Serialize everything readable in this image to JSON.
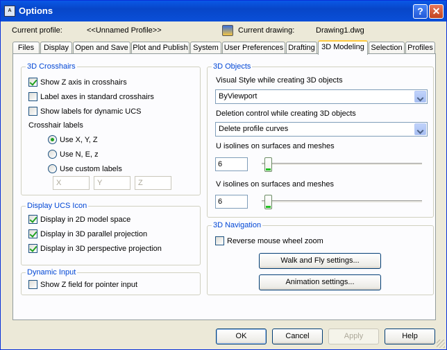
{
  "window": {
    "title": "Options",
    "icon": "autocad-icon",
    "help_glyph": "?",
    "close_glyph": "✕"
  },
  "profile": {
    "current_profile_label": "Current profile:",
    "current_profile_value": "<<Unnamed Profile>>",
    "current_drawing_label": "Current drawing:",
    "current_drawing_value": "Drawing1.dwg"
  },
  "tabs": [
    "Files",
    "Display",
    "Open and Save",
    "Plot and Publish",
    "System",
    "User Preferences",
    "Drafting",
    "3D Modeling",
    "Selection",
    "Profiles"
  ],
  "active_tab": "3D Modeling",
  "crosshairs": {
    "title": "3D Crosshairs",
    "show_z": {
      "label": "Show Z axis in crosshairs",
      "checked": true
    },
    "label_axes": {
      "label": "Label axes in standard crosshairs",
      "checked": false
    },
    "show_labels_ucs": {
      "label": "Show labels for dynamic UCS",
      "checked": false
    },
    "crosshair_labels_title": "Crosshair labels",
    "radios": [
      {
        "label": "Use X, Y, Z",
        "checked": true
      },
      {
        "label": "Use N, E, z",
        "checked": false
      },
      {
        "label": "Use custom labels",
        "checked": false
      }
    ],
    "custom": [
      "X",
      "Y",
      "Z"
    ]
  },
  "ucs_icon": {
    "title": "Display UCS Icon",
    "items": [
      {
        "label": "Display in 2D model space",
        "checked": true
      },
      {
        "label": "Display in 3D parallel projection",
        "checked": true
      },
      {
        "label": "Display in 3D perspective projection",
        "checked": true
      }
    ]
  },
  "dynamic_input": {
    "title": "Dynamic Input",
    "show_z_field": {
      "label": "Show Z field for pointer input",
      "checked": false
    }
  },
  "objects": {
    "title": "3D Objects",
    "visual_style_label": "Visual Style while creating 3D objects",
    "visual_style_value": "ByViewport",
    "deletion_label": "Deletion control while creating 3D objects",
    "deletion_value": "Delete profile curves",
    "u_isolines_label": "U isolines on surfaces and meshes",
    "u_isolines_value": "6",
    "v_isolines_label": "V isolines on surfaces and meshes",
    "v_isolines_value": "6"
  },
  "navigation": {
    "title": "3D Navigation",
    "reverse_zoom": {
      "label": "Reverse mouse wheel zoom",
      "checked": false
    },
    "walk_fly_button": "Walk and Fly settings...",
    "animation_button": "Animation settings..."
  },
  "footer": {
    "ok": "OK",
    "cancel": "Cancel",
    "apply": "Apply",
    "help": "Help"
  }
}
